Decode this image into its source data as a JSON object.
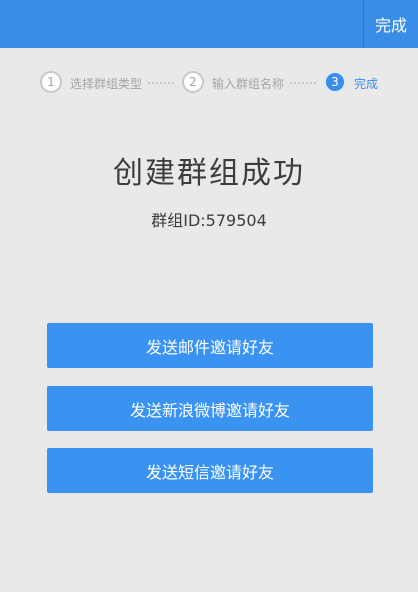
{
  "header": {
    "action_label": "完成"
  },
  "steps": [
    {
      "number": "1",
      "label": "选择群组类型"
    },
    {
      "number": "2",
      "label": "输入群组名称"
    },
    {
      "number": "3",
      "label": "完成"
    }
  ],
  "main": {
    "title": "创建群组成功",
    "group_id": "群组ID:579504"
  },
  "buttons": {
    "email": "发送邮件邀请好友",
    "weibo": "发送新浪微博邀请好友",
    "sms": "发送短信邀请好友"
  },
  "colors": {
    "accent": "#3a8de6",
    "background": "#e9e9e9"
  }
}
